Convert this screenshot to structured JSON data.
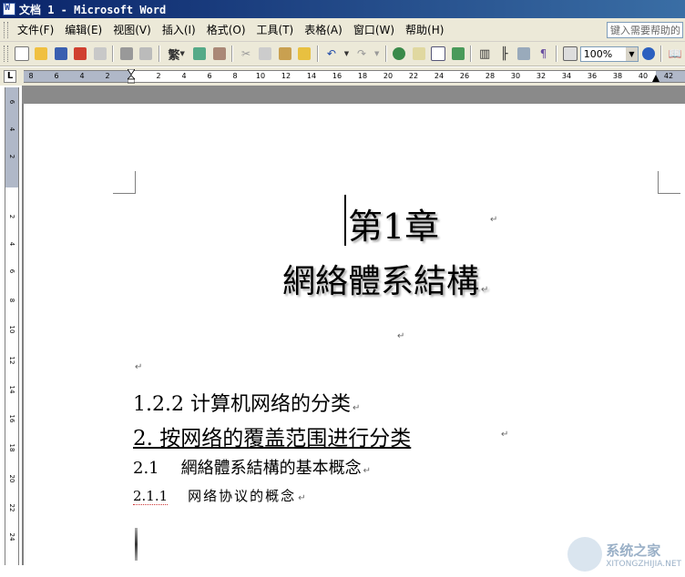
{
  "window": {
    "title": "文档 1 - Microsoft Word"
  },
  "menu": {
    "items": [
      "文件(F)",
      "编辑(E)",
      "视图(V)",
      "插入(I)",
      "格式(O)",
      "工具(T)",
      "表格(A)",
      "窗口(W)",
      "帮助(H)"
    ],
    "help_placeholder": "键入需要帮助的"
  },
  "toolbar": {
    "traditional_label": "繁",
    "zoom_value": "100%",
    "icons": [
      "new-icon",
      "open-icon",
      "save-icon",
      "permission-icon",
      "email-icon",
      "print-icon",
      "print-preview-icon",
      "traditional-chinese-icon",
      "spelling-icon",
      "research-icon",
      "cut-icon",
      "copy-icon",
      "paste-icon",
      "format-painter-icon",
      "undo-icon",
      "redo-icon",
      "hyperlink-icon",
      "tables-borders-icon",
      "insert-table-icon",
      "insert-excel-icon",
      "columns-icon",
      "drawing-icon",
      "document-map-icon",
      "show-hide-icon",
      "zoom-icon",
      "help-icon",
      "read-icon"
    ]
  },
  "ruler": {
    "h_labels": [
      "8",
      "6",
      "4",
      "2",
      "2",
      "4",
      "6",
      "8",
      "10",
      "12",
      "14",
      "16",
      "18",
      "20",
      "22",
      "24",
      "26",
      "28",
      "30",
      "32",
      "34",
      "36",
      "38",
      "40",
      "42"
    ],
    "v_labels": [
      "6",
      "4",
      "2",
      "2",
      "4",
      "6",
      "8",
      "10",
      "12",
      "14",
      "16",
      "18",
      "20",
      "22",
      "24"
    ]
  },
  "document": {
    "chapter_heading": "第1章",
    "chapter_title": "網絡體系結構",
    "heading_122": "1.2.2  计算机网络的分类",
    "heading_2": "2.  按网络的覆盖范围进行分类",
    "heading_21_num": "2.1",
    "heading_21_text": "網絡體系結構的基本概念",
    "heading_211_num": "2.1.1",
    "heading_211_text": "网络协议的概念",
    "paragraph_mark": "↵"
  },
  "watermark": {
    "text": "系统之家",
    "url": "XITONGZHIJIA.NET"
  },
  "colors": {
    "titlebar": "#0a246a",
    "chrome": "#ece9d8",
    "workspace": "#808080"
  }
}
